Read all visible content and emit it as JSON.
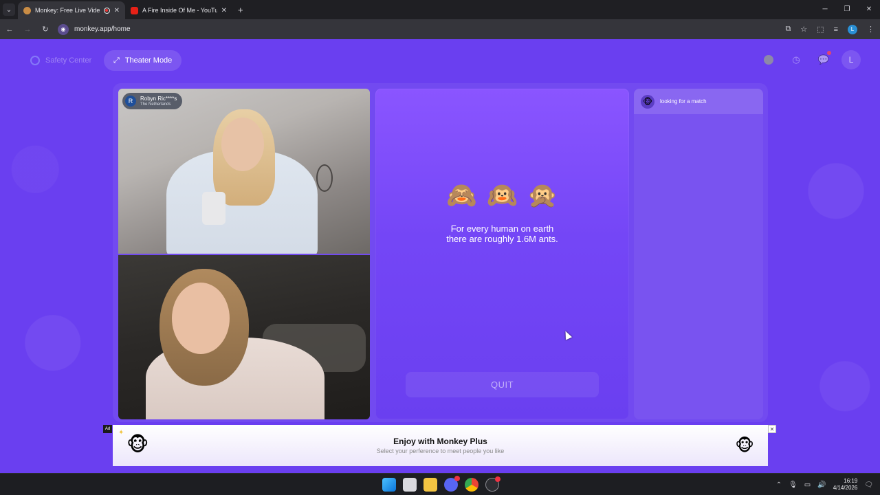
{
  "browser": {
    "tabs": [
      {
        "title": "Monkey: Free Live Video Ch",
        "active": true
      },
      {
        "title": "A Fire Inside Of Me - YouTube",
        "active": false
      }
    ],
    "url": "monkey.app/home",
    "profile_initial": "L"
  },
  "header": {
    "safety_center": "Safety Center",
    "theater_mode": "Theater Mode",
    "user_initial": "L"
  },
  "partner": {
    "initial": "R",
    "name": "Robyn Ric****s",
    "country": "The Netherlands"
  },
  "center": {
    "monkeys": [
      "🙈",
      "🙉",
      "🙊"
    ],
    "fact_line1": "For every human on earth",
    "fact_line2": "there are roughly 1.6M ants.",
    "quit_label": "QUIT"
  },
  "chat": {
    "status": "looking for a match",
    "icon": "🐵"
  },
  "ad": {
    "tag": "Ad",
    "title": "Enjoy with Monkey Plus",
    "subtitle": "Select your perference to meet people you like",
    "icon": "🐵"
  },
  "taskbar": {
    "time": "16:19",
    "date": "4/14/2026"
  },
  "colors": {
    "page_bg": "#6a3ff0",
    "panel_top": "#8a55ff"
  }
}
